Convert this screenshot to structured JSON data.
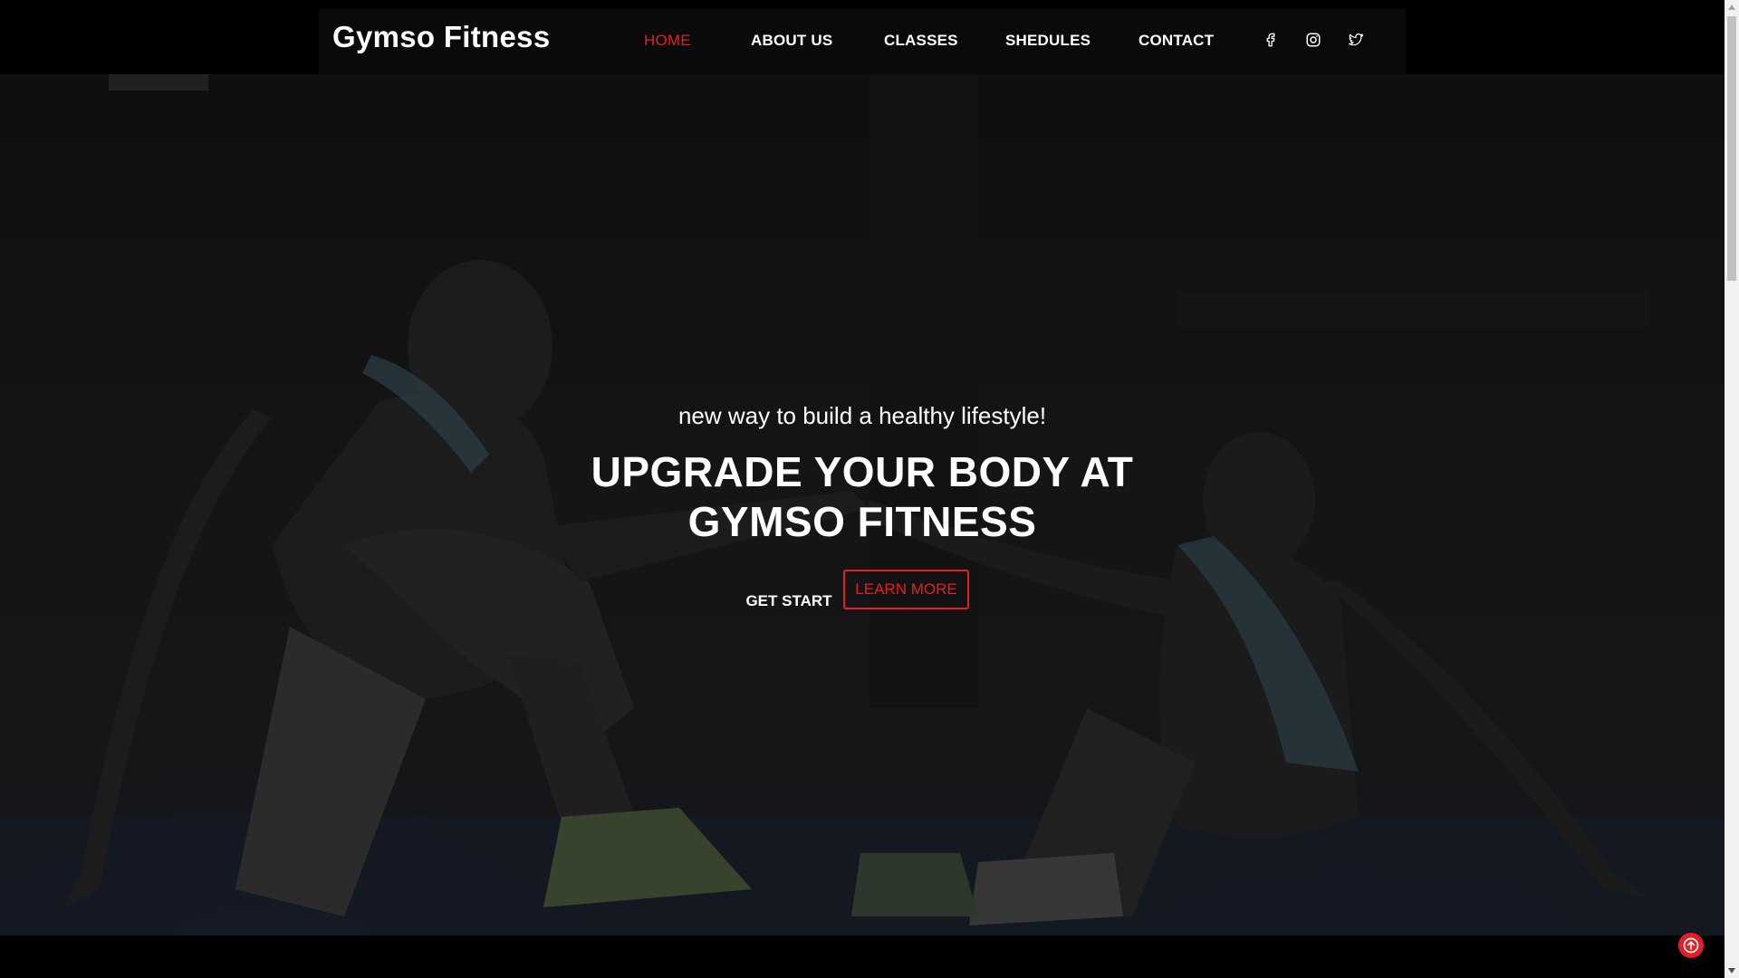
{
  "brand": "Gymso Fitness",
  "nav": {
    "items": [
      {
        "label": "HOME",
        "active": true
      },
      {
        "label": "ABOUT US",
        "active": false
      },
      {
        "label": "CLASSES",
        "active": false
      },
      {
        "label": "SHEDULES",
        "active": false
      },
      {
        "label": "CONTACT",
        "active": false
      }
    ],
    "social_icons": [
      "facebook-icon",
      "instagram-icon",
      "twitter-icon"
    ]
  },
  "hero": {
    "tagline": "new way to build a healthy lifestyle!",
    "headline_line1": "UPGRADE YOUR BODY AT",
    "headline_line2": "GYMSO FITNESS",
    "primary_button": "GET START",
    "secondary_button": "LEARN MORE"
  },
  "colors": {
    "accent": "#e41e26",
    "background": "#000000",
    "text": "#ffffff"
  },
  "scroll_top_icon": "arrow-up-circle-icon"
}
